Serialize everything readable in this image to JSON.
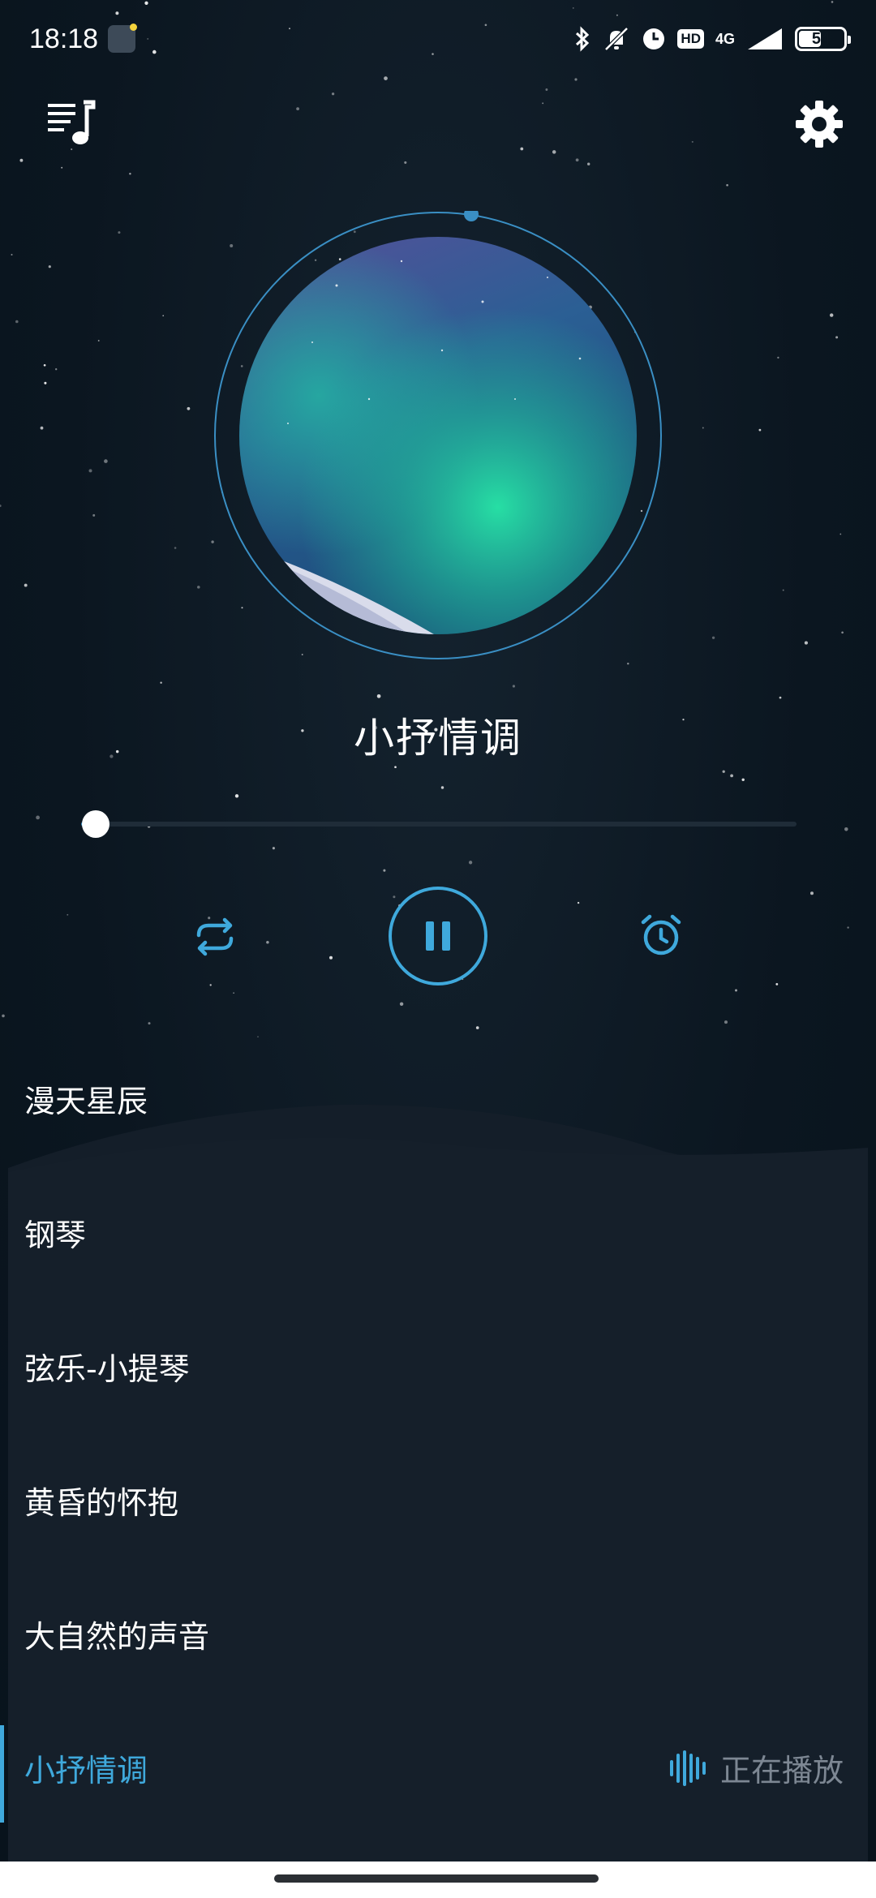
{
  "status_bar": {
    "time": "18:18",
    "network": "4G",
    "hd": "HD",
    "battery": "54",
    "battery_level": 0.54
  },
  "header": {
    "playlist_icon": "playlist-music-icon",
    "settings_icon": "gear-icon"
  },
  "player": {
    "title": "小抒情调",
    "progress": 0.02,
    "controls": {
      "repeat_icon": "repeat-icon",
      "pause_icon": "pause-icon",
      "timer_icon": "alarm-clock-icon"
    }
  },
  "playlist": {
    "items": [
      {
        "label": "漫天星辰"
      },
      {
        "label": "钢琴"
      },
      {
        "label": "弦乐-小提琴"
      },
      {
        "label": "黄昏的怀抱"
      },
      {
        "label": "大自然的声音"
      },
      {
        "label": "小抒情调"
      }
    ],
    "now_playing_label": "正在播放"
  },
  "colors": {
    "accent": "#3fa9dc",
    "background": "#0b1620",
    "panel": "#141e29"
  }
}
